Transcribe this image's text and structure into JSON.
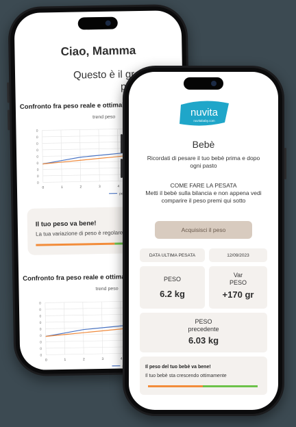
{
  "back_screen": {
    "greeting": "Ciao, Mamma",
    "subtitle": "Questo è il grafico del tuo peso",
    "section_title": "Confronto fra peso reale e ottimale",
    "chart_title": "trend peso",
    "legend_weight": "peso",
    "legend_optimal": "ottimale",
    "status_card": {
      "title": "Il tuo peso va bene!",
      "description": "La tua variazione di peso è regolare"
    }
  },
  "front_screen": {
    "logo_text": "nuvita",
    "logo_url_text": "nuvitababy.com",
    "title": "Bebè",
    "reminder": "Ricordati di pesare il tuo bebè prima e dopo ogni pasto",
    "howto_title": "COME FARE LA PESATA",
    "howto_text": "Metti il bebè sulla bilancia e non appena vedi comparire il peso premi qui sotto",
    "acquire_button": "Acquisisci il peso",
    "last_weighing_label": "DATA ULTIMA PESATA",
    "last_weighing_date": "12/09/2023",
    "weight_label": "PESO",
    "weight_value": "6.2 kg",
    "var_label": "Var PESO",
    "var_value": "+170 gr",
    "prev_label": "PESO precedente",
    "prev_value": "6.03 kg",
    "status": {
      "title": "Il peso del tuo bebè va bene!",
      "description": "Il tuo bebè sta crescendo ottimamente"
    }
  },
  "colors": {
    "background": "#3c4a52",
    "accent_blue": "#1fa6c9",
    "button_beige": "#d8cbbf",
    "card_bg": "#f4f1ee",
    "status_orange": "#f28c3a",
    "status_green": "#6cc24a",
    "line_blue": "#4a74c4",
    "line_orange": "#f08a3c"
  },
  "chart_data": [
    {
      "type": "line",
      "title": "trend peso",
      "x": [
        0,
        1,
        2,
        3,
        4,
        5,
        6,
        7,
        8
      ],
      "series": [
        {
          "name": "peso",
          "values": [
            5.8,
            5.9,
            6.0,
            6.05,
            6.1,
            6.15,
            6.2,
            6.25,
            6.3
          ]
        },
        {
          "name": "ottimale",
          "values": [
            5.8,
            5.85,
            5.9,
            5.95,
            6.0,
            6.05,
            6.1,
            6.15,
            6.2
          ]
        }
      ],
      "xlim": [
        0,
        8
      ],
      "grid": true
    },
    {
      "type": "line",
      "title": "trend peso",
      "x": [
        0,
        1,
        2,
        3,
        4,
        5,
        6,
        7,
        8
      ],
      "series": [
        {
          "name": "peso",
          "values": [
            5.8,
            5.9,
            6.0,
            6.05,
            6.1,
            6.15,
            6.2,
            6.25,
            6.3
          ]
        },
        {
          "name": "ottimale",
          "values": [
            5.8,
            5.85,
            5.9,
            5.95,
            6.0,
            6.05,
            6.1,
            6.15,
            6.2
          ]
        }
      ],
      "xlim": [
        0,
        8
      ],
      "grid": true
    }
  ]
}
